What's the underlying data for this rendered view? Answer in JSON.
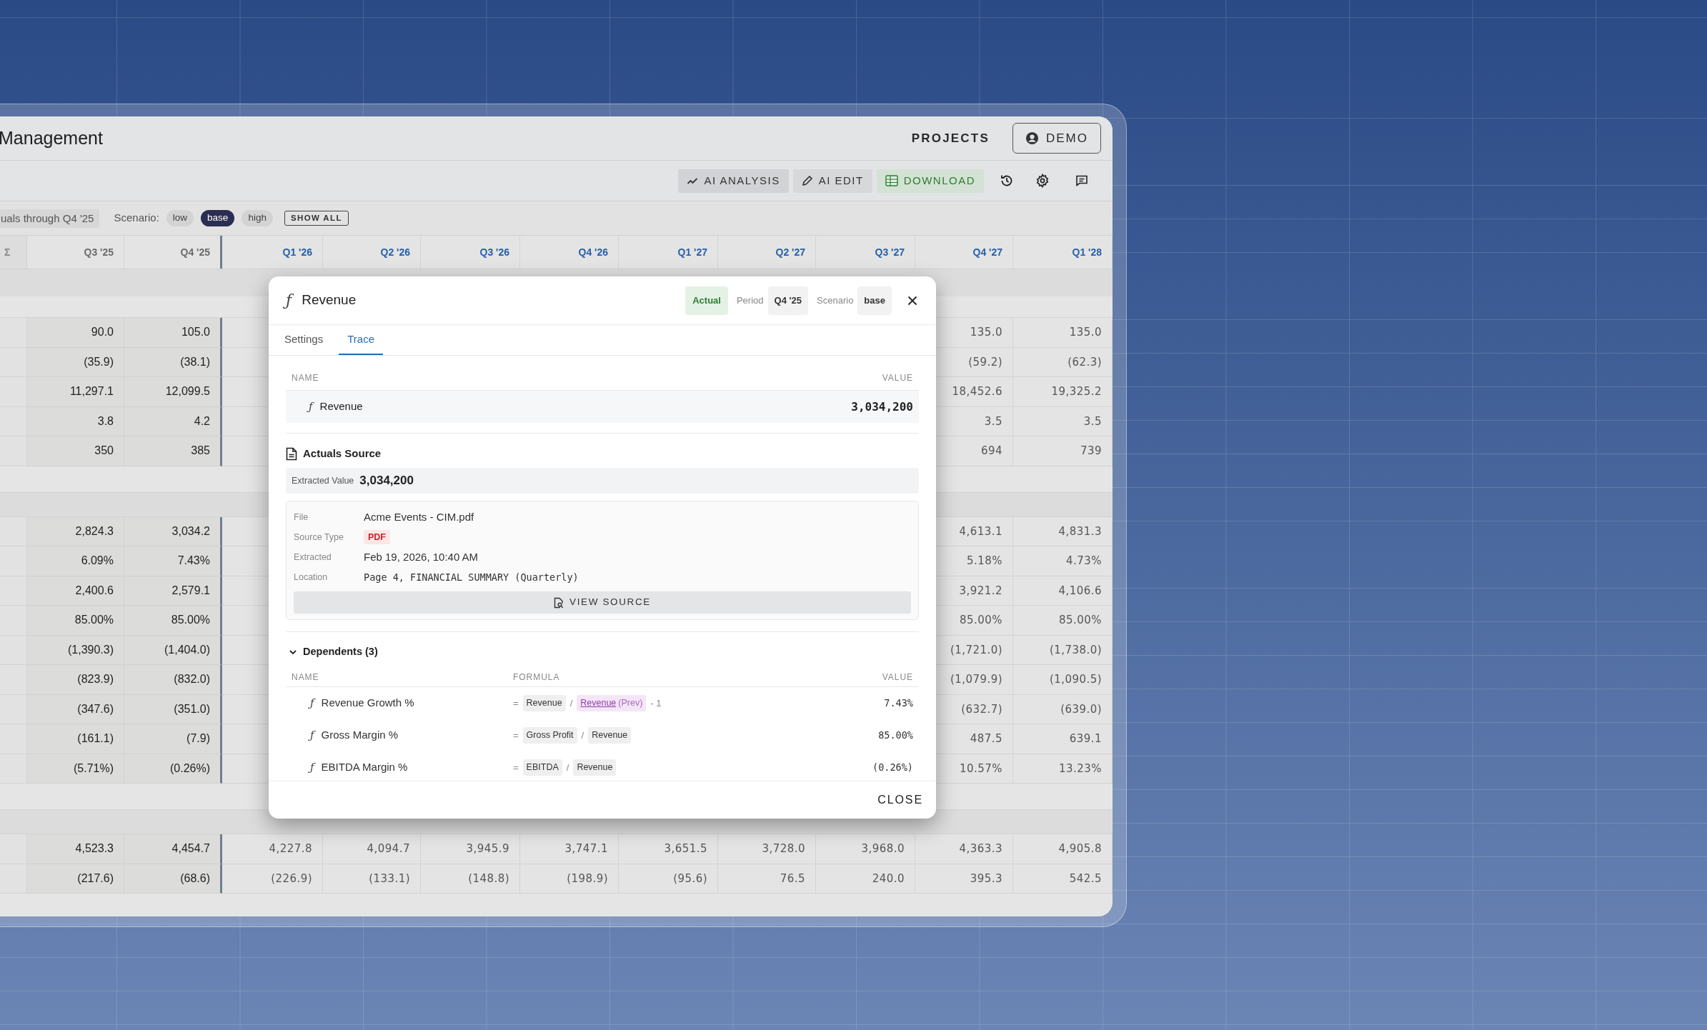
{
  "header": {
    "title": "Management",
    "nav_link": "PROJECTS",
    "user_button": "DEMO"
  },
  "toolbar": {
    "buttons": [
      {
        "kind": "analysis",
        "label": "AI ANALYSIS"
      },
      {
        "kind": "edit",
        "label": "AI EDIT"
      },
      {
        "kind": "download",
        "label": "DOWNLOAD"
      }
    ]
  },
  "filters": {
    "actuals_note": "uals through Q4 '25",
    "scenario_label": "Scenario:",
    "scenarios": [
      {
        "label": "low",
        "selected": false
      },
      {
        "label": "base",
        "selected": true
      },
      {
        "label": "high",
        "selected": false
      }
    ],
    "show_all": "SHOW ALL"
  },
  "table": {
    "columns": [
      {
        "label": "Σ",
        "kind": "sum"
      },
      {
        "label": "Q3 '25",
        "kind": "actual"
      },
      {
        "label": "Q4 '25",
        "kind": "actual"
      },
      {
        "label": "Q1 '26",
        "kind": "forecast"
      },
      {
        "label": "Q2 '26",
        "kind": "forecast"
      },
      {
        "label": "Q3 '26",
        "kind": "forecast"
      },
      {
        "label": "Q4 '26",
        "kind": "forecast"
      },
      {
        "label": "Q1 '27",
        "kind": "forecast"
      },
      {
        "label": "Q2 '27",
        "kind": "forecast"
      },
      {
        "label": "Q3 '27",
        "kind": "forecast"
      },
      {
        "label": "Q4 '27",
        "kind": "forecast"
      },
      {
        "label": "Q1 '28",
        "kind": "forecast"
      }
    ],
    "sections": [
      {
        "rows": [
          {
            "cells": [
              null,
              "90.0",
              "105.0",
              null,
              null,
              null,
              null,
              null,
              null,
              null,
              "135.0",
              "135.0"
            ]
          },
          {
            "cells": [
              null,
              "(35.9)",
              "(38.1)",
              null,
              null,
              null,
              null,
              null,
              null,
              null,
              "(59.2)",
              "(62.3)"
            ]
          },
          {
            "cells": [
              null,
              "11,297.1",
              "12,099.5",
              null,
              null,
              null,
              null,
              null,
              null,
              null,
              "18,452.6",
              "19,325.2"
            ]
          },
          {
            "cells": [
              null,
              "3.8",
              "4.2",
              null,
              null,
              null,
              null,
              null,
              null,
              null,
              "3.5",
              "3.5"
            ]
          },
          {
            "cells": [
              null,
              "350",
              "385",
              null,
              null,
              null,
              null,
              null,
              null,
              null,
              "694",
              "739"
            ]
          }
        ]
      },
      {
        "rows": [
          {
            "cells": [
              null,
              "2,824.3",
              "3,034.2",
              null,
              null,
              null,
              null,
              null,
              null,
              null,
              "4,613.1",
              "4,831.3"
            ]
          },
          {
            "cells": [
              null,
              "6.09%",
              "7.43%",
              null,
              null,
              null,
              null,
              null,
              null,
              null,
              "5.18%",
              "4.73%"
            ]
          },
          {
            "cells": [
              null,
              "2,400.6",
              "2,579.1",
              null,
              null,
              null,
              null,
              null,
              null,
              null,
              "3,921.2",
              "4,106.6"
            ]
          },
          {
            "cells": [
              null,
              "85.00%",
              "85.00%",
              null,
              null,
              null,
              null,
              null,
              null,
              null,
              "85.00%",
              "85.00%"
            ]
          },
          {
            "cells": [
              null,
              "(1,390.3)",
              "(1,404.0)",
              null,
              null,
              null,
              null,
              null,
              null,
              null,
              "(1,721.0)",
              "(1,738.0)"
            ]
          },
          {
            "cells": [
              null,
              "(823.9)",
              "(832.0)",
              null,
              null,
              null,
              null,
              null,
              null,
              null,
              "(1,079.9)",
              "(1,090.5)"
            ]
          },
          {
            "cells": [
              null,
              "(347.6)",
              "(351.0)",
              null,
              null,
              null,
              null,
              null,
              null,
              null,
              "(632.7)",
              "(639.0)"
            ]
          },
          {
            "cells": [
              null,
              "(161.1)",
              "(7.9)",
              null,
              null,
              null,
              null,
              null,
              null,
              null,
              "487.5",
              "639.1"
            ]
          },
          {
            "cells": [
              null,
              "(5.71%)",
              "(0.26%)",
              null,
              null,
              null,
              null,
              null,
              null,
              null,
              "10.57%",
              "13.23%"
            ]
          }
        ]
      },
      {
        "rows": [
          {
            "cells": [
              null,
              "4,523.3",
              "4,454.7",
              "4,227.8",
              "4,094.7",
              "3,945.9",
              "3,747.1",
              "3,651.5",
              "3,728.0",
              "3,968.0",
              "4,363.3",
              "4,905.8"
            ]
          },
          {
            "cells": [
              null,
              "(217.6)",
              "(68.6)",
              "(226.9)",
              "(133.1)",
              "(148.8)",
              "(198.9)",
              "(95.6)",
              "76.5",
              "240.0",
              "395.3",
              "542.5"
            ]
          }
        ]
      }
    ]
  },
  "dialog": {
    "icon": "ƒ",
    "title": "Revenue",
    "status_badge": "Actual",
    "period_label": "Period",
    "period": "Q4 '25",
    "scenario_label": "Scenario",
    "scenario": "base",
    "tabs": [
      {
        "label": "Settings",
        "selected": false
      },
      {
        "label": "Trace",
        "selected": true
      }
    ],
    "trace": {
      "columns": [
        "NAME",
        "VALUE"
      ],
      "row": {
        "icon": "ƒ",
        "name": "Revenue",
        "value": "3,034,200"
      }
    },
    "actuals_source": {
      "title": "Actuals Source",
      "extracted_label": "Extracted Value",
      "extracted_value": "3,034,200",
      "fields": [
        {
          "label": "File",
          "value": "Acme Events - CIM.pdf",
          "kind": "text"
        },
        {
          "label": "Source Type",
          "value": "PDF",
          "kind": "badge"
        },
        {
          "label": "Extracted",
          "value": "Feb 19, 2026, 10:40 AM",
          "kind": "text"
        },
        {
          "label": "Location",
          "value": "Page 4, FINANCIAL SUMMARY (Quarterly)",
          "kind": "mono"
        }
      ],
      "button": "VIEW SOURCE"
    },
    "dependents": {
      "title": "Dependents (3)",
      "expanded": true,
      "columns": [
        "NAME",
        "FORMULA",
        "VALUE"
      ],
      "rows": [
        {
          "icon": "ƒ",
          "name": "Revenue Growth %",
          "formula": [
            {
              "kind": "op",
              "text": "="
            },
            {
              "kind": "ref",
              "text": "Revenue"
            },
            {
              "kind": "op",
              "text": "/"
            },
            {
              "kind": "prev_ref",
              "text": "Revenue",
              "suffix": "(Prev)"
            },
            {
              "kind": "op",
              "text": "- 1"
            }
          ],
          "value": "7.43%"
        },
        {
          "icon": "ƒ",
          "name": "Gross Margin %",
          "formula": [
            {
              "kind": "op",
              "text": "="
            },
            {
              "kind": "ref",
              "text": "Gross Profit"
            },
            {
              "kind": "op",
              "text": "/"
            },
            {
              "kind": "ref",
              "text": "Revenue"
            }
          ],
          "value": "85.00%"
        },
        {
          "icon": "ƒ",
          "name": "EBITDA Margin %",
          "formula": [
            {
              "kind": "op",
              "text": "="
            },
            {
              "kind": "ref",
              "text": "EBITDA"
            },
            {
              "kind": "op",
              "text": "/"
            },
            {
              "kind": "ref",
              "text": "Revenue"
            }
          ],
          "value": "(0.26%)"
        }
      ]
    },
    "close_button": "CLOSE"
  }
}
